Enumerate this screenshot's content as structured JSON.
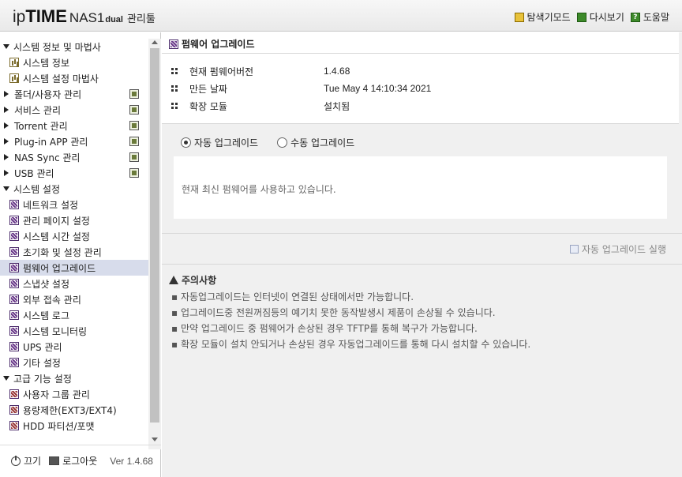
{
  "header": {
    "logo_ip": "ip",
    "logo_time": "TIME",
    "logo_model": "NAS1",
    "logo_dual": "dual",
    "logo_manager": "관리툴",
    "links": {
      "explorer": "탐색기모드",
      "refresh": "다시보기",
      "help": "도움말"
    }
  },
  "sidebar": {
    "items": [
      {
        "label": "시스템 정보 및 마법사",
        "level": "top",
        "expanded": true
      },
      {
        "label": "시스템 정보",
        "level": "sub",
        "icon": "chart-icon"
      },
      {
        "label": "시스템 설정 마법사",
        "level": "sub",
        "icon": "chart-icon"
      },
      {
        "label": "폴더/사용자 관리",
        "level": "top",
        "expanded": false,
        "icon": "folder-user-icon"
      },
      {
        "label": "서비스 관리",
        "level": "top",
        "expanded": false,
        "icon": "service-icon"
      },
      {
        "label": "Torrent 관리",
        "level": "top",
        "expanded": false,
        "icon": "torrent-icon"
      },
      {
        "label": "Plug-in APP 관리",
        "level": "top",
        "expanded": false,
        "icon": "plugin-icon"
      },
      {
        "label": "NAS Sync 관리",
        "level": "top",
        "expanded": false,
        "icon": "sync-icon"
      },
      {
        "label": "USB 관리",
        "level": "top",
        "expanded": false,
        "icon": "usb-icon"
      },
      {
        "label": "시스템 설정",
        "level": "top",
        "expanded": true
      },
      {
        "label": "네트워크 설정",
        "level": "sub",
        "icon": "gear-icon"
      },
      {
        "label": "관리 페이지 설정",
        "level": "sub",
        "icon": "gear-icon"
      },
      {
        "label": "시스템 시간 설정",
        "level": "sub",
        "icon": "gear-icon"
      },
      {
        "label": "초기화 및 설정 관리",
        "level": "sub",
        "icon": "gear-icon"
      },
      {
        "label": "펌웨어 업그레이드",
        "level": "sub",
        "icon": "gear-icon",
        "active": true
      },
      {
        "label": "스냅샷 설정",
        "level": "sub",
        "icon": "gear-icon"
      },
      {
        "label": "외부 접속 관리",
        "level": "sub",
        "icon": "gear-icon"
      },
      {
        "label": "시스템 로그",
        "level": "sub",
        "icon": "gear-icon"
      },
      {
        "label": "시스템 모니터링",
        "level": "sub",
        "icon": "gear-icon"
      },
      {
        "label": "UPS 관리",
        "level": "sub",
        "icon": "gear-icon"
      },
      {
        "label": "기타 설정",
        "level": "sub",
        "icon": "gear-icon"
      },
      {
        "label": "고급 기능 설정",
        "level": "top",
        "expanded": true
      },
      {
        "label": "사용자 그룹 관리",
        "level": "sub",
        "icon": "gear-red-icon"
      },
      {
        "label": "용량제한(EXT3/EXT4)",
        "level": "sub",
        "icon": "gear-red-icon"
      },
      {
        "label": "HDD 파티션/포맷",
        "level": "sub",
        "icon": "gear-red-icon"
      }
    ],
    "footer": {
      "power": "끄기",
      "logout": "로그아웃",
      "version": "Ver 1.4.68"
    }
  },
  "main": {
    "title": "펌웨어 업그레이드",
    "info": [
      {
        "label": "현재 펌웨어버전",
        "value": "1.4.68"
      },
      {
        "label": "만든 날짜",
        "value": "Tue May 4 14:10:34 2021"
      },
      {
        "label": "확장 모듈",
        "value": "설치됨"
      }
    ],
    "radio_auto": "자동 업그레이드",
    "radio_manual": "수동 업그레이드",
    "radio_selected": "auto",
    "status": "현재 최신 펌웨어를 사용하고 있습니다.",
    "run_button": "자동 업그레이드 실행",
    "notice_title": "주의사항",
    "notices": [
      "자동업그레이드는 인터넷이 연결된 상태에서만 가능합니다.",
      "업그레이드중 전원꺼짐등의 예기치 못한 동작발생시 제품이 손상될 수 있습니다.",
      "만약 업그레이드 중 펌웨어가 손상된 경우 TFTP를 통해 복구가 가능합니다.",
      "확장 모듈이 설치 안되거나 손상된 경우 자동업그레이드를 통해 다시 설치할 수 있습니다."
    ]
  }
}
